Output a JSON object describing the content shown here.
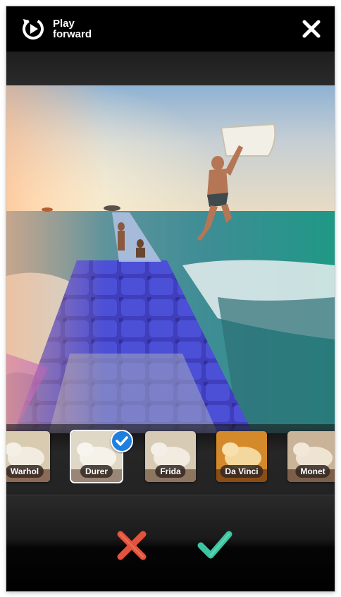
{
  "header": {
    "play_label_line1": "Play",
    "play_label_line2": "forward",
    "play_icon": "rotate-play-icon",
    "close_icon": "close-icon"
  },
  "filters": [
    {
      "name": "Warhol",
      "selected": false
    },
    {
      "name": "Durer",
      "selected": true
    },
    {
      "name": "Frida",
      "selected": false
    },
    {
      "name": "Da Vinci",
      "selected": false
    },
    {
      "name": "Monet",
      "selected": false
    }
  ],
  "actions": {
    "cancel_icon": "cross-icon",
    "confirm_icon": "checkmark-icon",
    "cancel_color": "#e0533d",
    "confirm_color": "#3cc4a0"
  },
  "colors": {
    "selection_badge": "#1f7fe0"
  }
}
